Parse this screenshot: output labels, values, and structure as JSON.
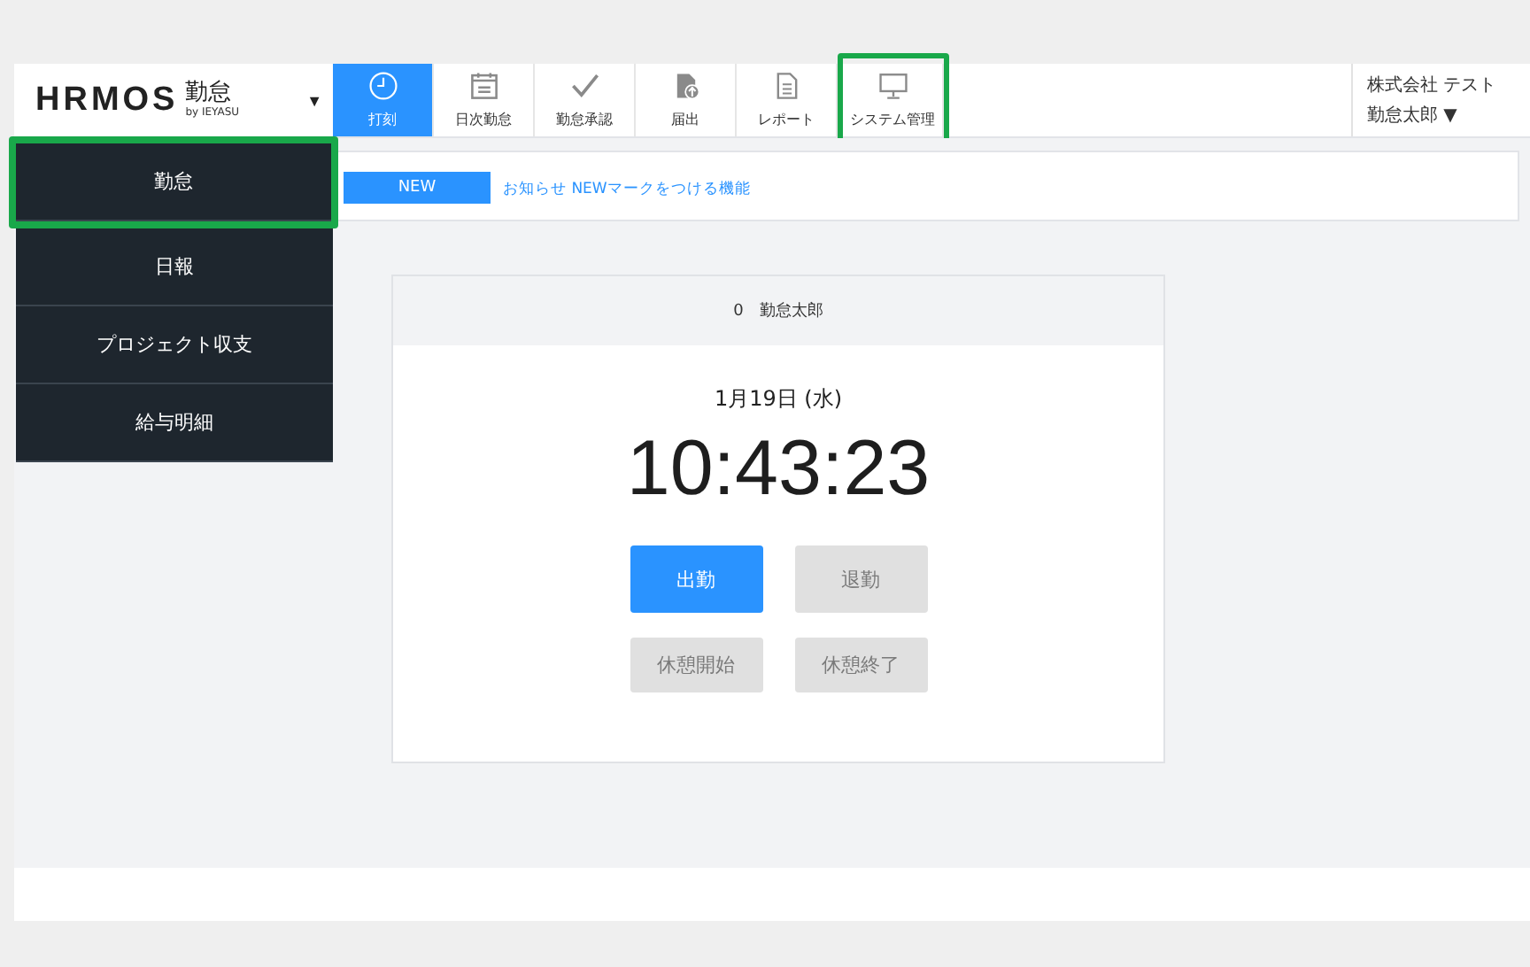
{
  "logo": {
    "brand": "HRMOS",
    "product": "勤怠",
    "byline": "by IEYASU",
    "caret": "▼"
  },
  "nav_tabs": [
    {
      "label": "打刻",
      "kind": "clock",
      "selected": true,
      "highlighted": false
    },
    {
      "label": "日次勤怠",
      "kind": "calendar",
      "selected": false,
      "highlighted": false
    },
    {
      "label": "勤怠承認",
      "kind": "check",
      "selected": false,
      "highlighted": false
    },
    {
      "label": "届出",
      "kind": "upload",
      "selected": false,
      "highlighted": false
    },
    {
      "label": "レポート",
      "kind": "document",
      "selected": false,
      "highlighted": false
    },
    {
      "label": "システム管理",
      "kind": "monitor",
      "selected": false,
      "highlighted": true
    }
  ],
  "user": {
    "company": "株式会社 テスト",
    "name": "勤怠太郎",
    "caret": "▼"
  },
  "menu": [
    {
      "label": "勤怠",
      "highlighted": true
    },
    {
      "label": "日報",
      "highlighted": false
    },
    {
      "label": "プロジェクト収支",
      "highlighted": false
    },
    {
      "label": "給与明細",
      "highlighted": false
    }
  ],
  "notice": {
    "badge": "NEW",
    "text": "お知らせ NEWマークをつける機能"
  },
  "punch_card": {
    "header": "0　勤怠太郎",
    "date": "1月19日 (水)",
    "time": "10:43:23",
    "buttons": [
      {
        "label": "出勤",
        "disabled": false
      },
      {
        "label": "退勤",
        "disabled": true
      },
      {
        "label": "休憩開始",
        "disabled": true
      },
      {
        "label": "休憩終了",
        "disabled": true
      }
    ]
  }
}
